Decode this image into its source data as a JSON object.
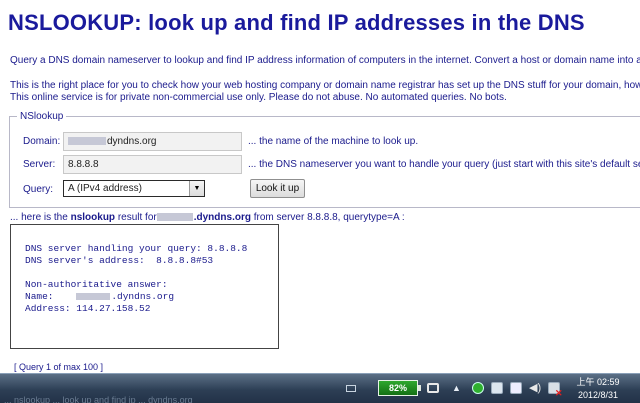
{
  "page": {
    "title": "NSLOOKUP: look up and find IP addresses in the DNS",
    "intro1": "Query a DNS domain nameserver to lookup and find IP address information of computers in the internet. Convert a host or domain name into an IP address.",
    "intro2a": "This is the right place for you to check how your web hosting company or domain name registrar has set up the DNS stuff for your domain, how your",
    "intro2b": "This online service is for private non-commercial use only. Please do not abuse. No automated queries. No bots."
  },
  "form": {
    "legend": "NSlookup",
    "domain_label": "Domain:",
    "domain_value": "dyndns.org",
    "domain_hint": "... the name of the machine to look up.",
    "server_label": "Server:",
    "server_value": "8.8.8.8",
    "server_hint": "... the DNS nameserver you want to handle your query (just start with this site's default server",
    "query_label": "Query:",
    "query_selected": "A (IPv4 address)",
    "submit_label": "Look it up"
  },
  "result": {
    "prefix": "... here is the",
    "keyword": "nslookup",
    "mid": "result for",
    "domain": ".dyndns.org",
    "suffix": "from server 8.8.8.8, querytype=A :",
    "line1": "DNS server handling your query: 8.8.8.8",
    "line2": "DNS server's address:  8.8.8.8#53",
    "line3": "Non-authoritative answer:",
    "line4_prefix": "Name:",
    "line4_domain": ".dyndns.org",
    "line5": "Address: 114.27.158.52",
    "query_count": "[ Query 1 of max 100 ]"
  },
  "taskbar": {
    "ghost_text": "... nslookup ... look up and find ip ... dyndns.org",
    "battery": "82%",
    "time": "上午 02:59",
    "date": "2012/8/31",
    "icons": [
      "tray-grip-icon",
      "battery-icon",
      "power-plug-icon",
      "show-hidden-icons-arrow",
      "green-status-icon",
      "display-icon",
      "action-center-flag-icon",
      "speaker-icon",
      "network-icon"
    ]
  }
}
